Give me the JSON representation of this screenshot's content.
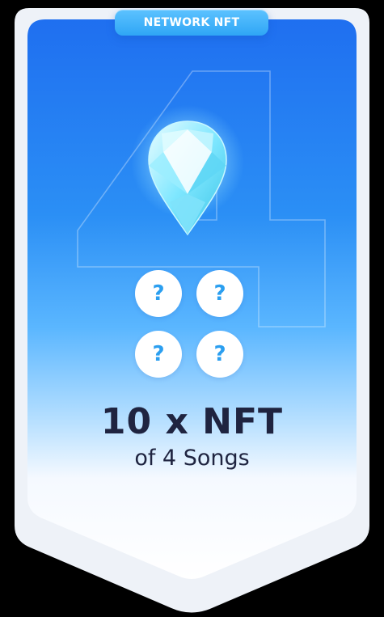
{
  "badge": {
    "label": "NETWORK NFT"
  },
  "watermark": {
    "text": "4"
  },
  "gem": {
    "icon": "diamond-gem-icon",
    "color": "#7fe7ff"
  },
  "slots": [
    {
      "label": "?"
    },
    {
      "label": "?"
    },
    {
      "label": "?"
    },
    {
      "label": "?"
    }
  ],
  "title": "10 x NFT",
  "subtitle": "of 4 Songs",
  "colors": {
    "accent_blue": "#2f8ff0",
    "text_dark": "#1f2440",
    "question_blue": "#2b9ff0"
  }
}
